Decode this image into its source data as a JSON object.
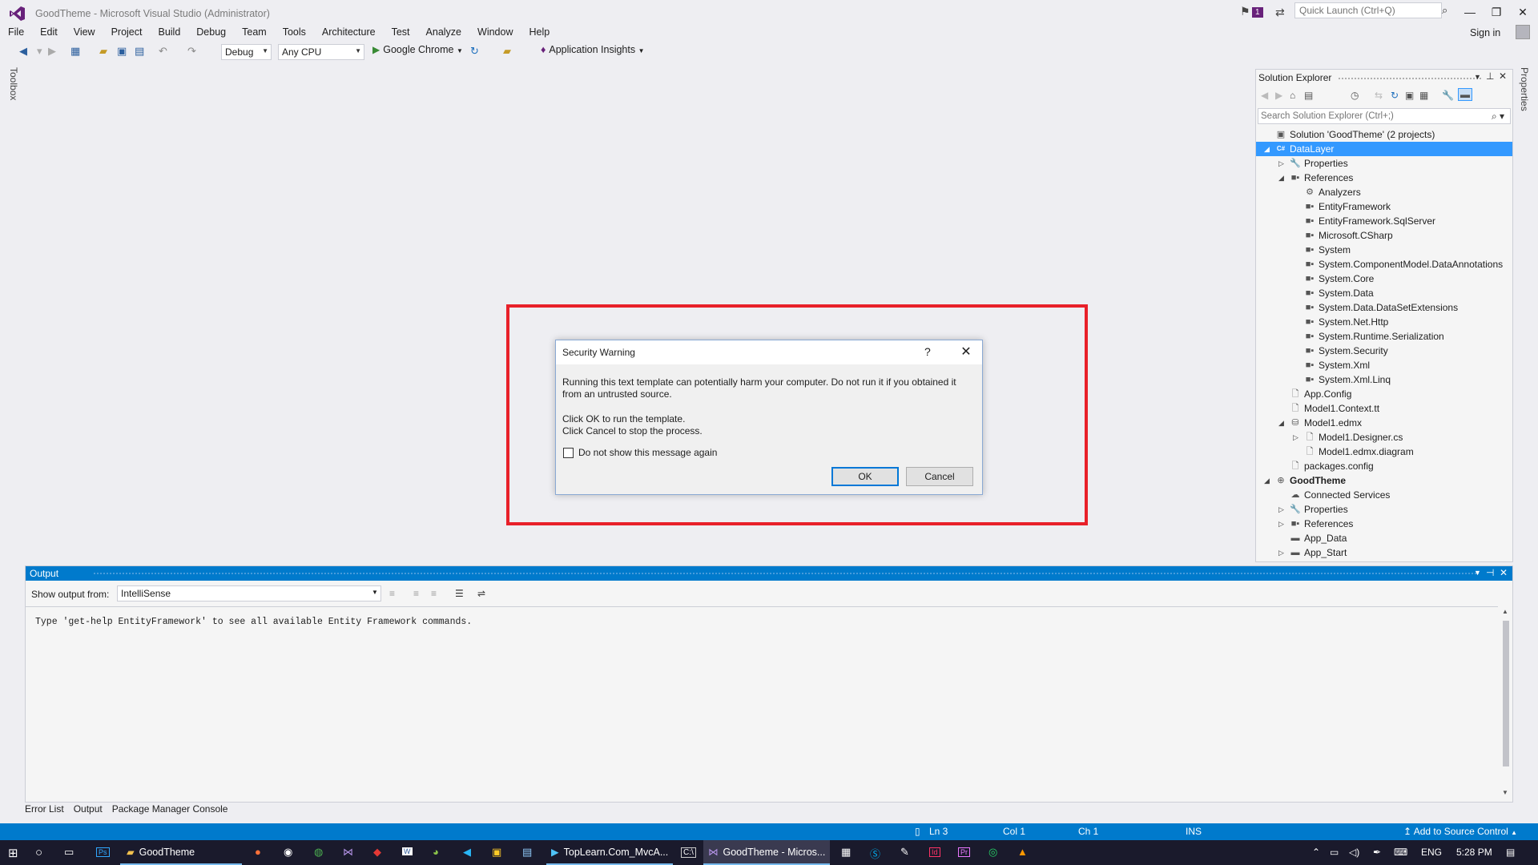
{
  "window": {
    "title": "GoodTheme - Microsoft Visual Studio (Administrator)",
    "notification_count": "1",
    "quick_launch_placeholder": "Quick Launch (Ctrl+Q)",
    "sign_in": "Sign in",
    "minimize": "—",
    "restore": "❐",
    "close": "✕"
  },
  "menu": [
    "File",
    "Edit",
    "View",
    "Project",
    "Build",
    "Debug",
    "Team",
    "Tools",
    "Architecture",
    "Test",
    "Analyze",
    "Window",
    "Help"
  ],
  "toolbar": {
    "configuration": "Debug",
    "platform": "Any CPU",
    "start_target": "Google Chrome",
    "app_insights": "Application Insights"
  },
  "side_tabs": {
    "toolbox": "Toolbox",
    "properties": "Properties"
  },
  "dialog": {
    "title": "Security Warning",
    "help": "?",
    "close": "✕",
    "message": "Running this text template can potentially harm your computer. Do not run it if you obtained it from an untrusted source.",
    "instruction_ok": "Click OK to run the template.",
    "instruction_cancel": "Click Cancel to stop the process.",
    "checkbox_label": "Do not show this message again",
    "checkbox_checked": false,
    "ok": "OK",
    "cancel": "Cancel"
  },
  "solution_explorer": {
    "title": "Solution Explorer",
    "search_placeholder": "Search Solution Explorer (Ctrl+;)",
    "items": [
      {
        "label": "Solution 'GoodTheme' (2 projects)",
        "level": 0,
        "expander": "",
        "icon": "solution-icon",
        "glyph": "▣",
        "selected": false
      },
      {
        "label": "DataLayer",
        "level": 0,
        "expander": "◢",
        "icon": "csharp-project-icon",
        "glyph": "C#",
        "selected": true
      },
      {
        "label": "Properties",
        "level": 1,
        "expander": "▷",
        "icon": "wrench-icon",
        "glyph": "🔧",
        "selected": false
      },
      {
        "label": "References",
        "level": 1,
        "expander": "◢",
        "icon": "references-icon",
        "glyph": "■▪",
        "selected": false
      },
      {
        "label": "Analyzers",
        "level": 2,
        "expander": "",
        "icon": "analyzer-icon",
        "glyph": "⚙",
        "selected": false
      },
      {
        "label": "EntityFramework",
        "level": 2,
        "expander": "",
        "icon": "reference-icon",
        "glyph": "■▪",
        "selected": false
      },
      {
        "label": "EntityFramework.SqlServer",
        "level": 2,
        "expander": "",
        "icon": "reference-icon",
        "glyph": "■▪",
        "selected": false
      },
      {
        "label": "Microsoft.CSharp",
        "level": 2,
        "expander": "",
        "icon": "reference-icon",
        "glyph": "■▪",
        "selected": false
      },
      {
        "label": "System",
        "level": 2,
        "expander": "",
        "icon": "reference-icon",
        "glyph": "■▪",
        "selected": false
      },
      {
        "label": "System.ComponentModel.DataAnnotations",
        "level": 2,
        "expander": "",
        "icon": "reference-icon",
        "glyph": "■▪",
        "selected": false
      },
      {
        "label": "System.Core",
        "level": 2,
        "expander": "",
        "icon": "reference-icon",
        "glyph": "■▪",
        "selected": false
      },
      {
        "label": "System.Data",
        "level": 2,
        "expander": "",
        "icon": "reference-icon",
        "glyph": "■▪",
        "selected": false
      },
      {
        "label": "System.Data.DataSetExtensions",
        "level": 2,
        "expander": "",
        "icon": "reference-icon",
        "glyph": "■▪",
        "selected": false
      },
      {
        "label": "System.Net.Http",
        "level": 2,
        "expander": "",
        "icon": "reference-icon",
        "glyph": "■▪",
        "selected": false
      },
      {
        "label": "System.Runtime.Serialization",
        "level": 2,
        "expander": "",
        "icon": "reference-icon",
        "glyph": "■▪",
        "selected": false
      },
      {
        "label": "System.Security",
        "level": 2,
        "expander": "",
        "icon": "reference-icon",
        "glyph": "■▪",
        "selected": false
      },
      {
        "label": "System.Xml",
        "level": 2,
        "expander": "",
        "icon": "reference-icon",
        "glyph": "■▪",
        "selected": false
      },
      {
        "label": "System.Xml.Linq",
        "level": 2,
        "expander": "",
        "icon": "reference-icon",
        "glyph": "■▪",
        "selected": false
      },
      {
        "label": "App.Config",
        "level": 1,
        "expander": "",
        "icon": "config-file-icon",
        "glyph": "🗋",
        "selected": false
      },
      {
        "label": "Model1.Context.tt",
        "level": 1,
        "expander": "",
        "icon": "text-template-icon",
        "glyph": "🗋",
        "selected": false
      },
      {
        "label": "Model1.edmx",
        "level": 1,
        "expander": "◢",
        "icon": "edmx-icon",
        "glyph": "⛁",
        "selected": false
      },
      {
        "label": "Model1.Designer.cs",
        "level": 2,
        "expander": "▷",
        "icon": "cs-file-icon",
        "glyph": "🗋",
        "selected": false
      },
      {
        "label": "Model1.edmx.diagram",
        "level": 2,
        "expander": "",
        "icon": "diagram-file-icon",
        "glyph": "🗋",
        "selected": false
      },
      {
        "label": "packages.config",
        "level": 1,
        "expander": "",
        "icon": "config-file-icon",
        "glyph": "🗋",
        "selected": false
      },
      {
        "label": "GoodTheme",
        "level": 0,
        "expander": "◢",
        "icon": "web-project-icon",
        "glyph": "⊕",
        "selected": false,
        "bold": true
      },
      {
        "label": "Connected Services",
        "level": 1,
        "expander": "",
        "icon": "connected-services-icon",
        "glyph": "☁",
        "selected": false
      },
      {
        "label": "Properties",
        "level": 1,
        "expander": "▷",
        "icon": "wrench-icon",
        "glyph": "🔧",
        "selected": false
      },
      {
        "label": "References",
        "level": 1,
        "expander": "▷",
        "icon": "references-icon",
        "glyph": "■▪",
        "selected": false
      },
      {
        "label": "App_Data",
        "level": 1,
        "expander": "",
        "icon": "folder-icon",
        "glyph": "▬",
        "selected": false
      },
      {
        "label": "App_Start",
        "level": 1,
        "expander": "▷",
        "icon": "folder-icon",
        "glyph": "▬",
        "selected": false
      }
    ]
  },
  "output": {
    "title": "Output",
    "show_output_from_label": "Show output from:",
    "source": "IntelliSense",
    "text": "Type 'get-help EntityFramework' to see all available Entity Framework commands."
  },
  "bottom_tabs": [
    "Error List",
    "Output",
    "Package Manager Console"
  ],
  "status_bar": {
    "line": "Ln 3",
    "col": "Col 1",
    "ch": "Ch 1",
    "mode": "INS",
    "source_control": "Add to Source Control"
  },
  "taskbar": {
    "apps": [
      {
        "label": "GoodTheme",
        "icon": "folder-icon",
        "state": "open"
      },
      {
        "label": "TopLearn.Com_MvcA...",
        "icon": "media-player-icon",
        "state": "open"
      },
      {
        "label": "GoodTheme - Micros...",
        "icon": "visual-studio-icon",
        "state": "active"
      }
    ],
    "language": "ENG",
    "time": "5:28 PM"
  },
  "colors": {
    "accent": "#007acc",
    "highlight_border": "#e8202a",
    "selection": "#3399ff"
  }
}
